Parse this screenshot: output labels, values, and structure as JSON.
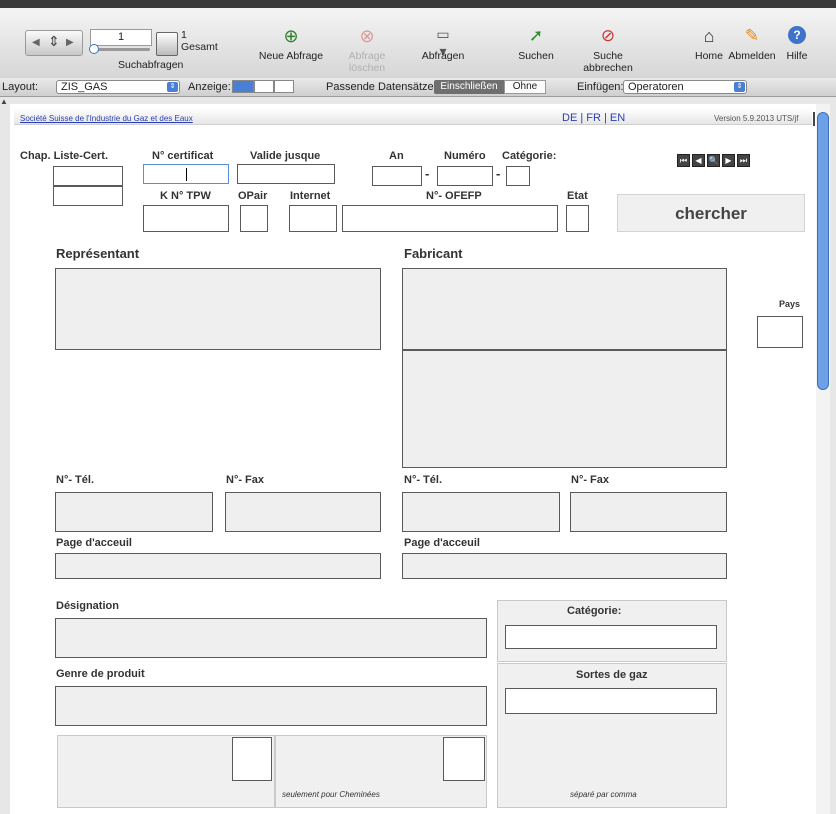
{
  "toolbar": {
    "record_number": "1",
    "total_count": "1",
    "total_label": "Gesamt",
    "search_queries_label": "Suchabfragen",
    "new_query": "Neue Abfrage",
    "delete_query": "Abfrage löschen",
    "queries": "Abfragen",
    "search": "Suchen",
    "cancel_search": "Suche abbrechen",
    "home": "Home",
    "logout": "Abmelden",
    "help": "Hilfe"
  },
  "statusbar": {
    "layout_label": "Layout:",
    "layout_value": "ZIS_GAS",
    "view_label": "Anzeige:",
    "matching_label": "Passende Datensätze:",
    "include": "Einschließen",
    "exclude": "Ohne",
    "insert_label": "Einfügen:",
    "insert_value": "Operatoren"
  },
  "header": {
    "org": "Société Suisse de l'Industrie du Gaz et des Eaux",
    "lang": "DE | FR | EN",
    "version": "Version 5.9.2013 UTS/jf"
  },
  "form": {
    "chap_liste": "Chap. Liste-Cert.",
    "certificat": "N° certificat",
    "valide": "Valide jusque",
    "an": "An",
    "numero": "Numéro",
    "categorie_top": "Catégorie:",
    "kn_tpw": "K N° TPW",
    "opair": "OPair",
    "internet": "Internet",
    "ofefp": "N°- OFEFP",
    "etat": "Etat",
    "dash": "-",
    "search_button": "chercher",
    "representant": "Représentant",
    "fabricant": "Fabricant",
    "pays": "Pays",
    "tel1": "N°- Tél.",
    "fax1": "N°- Fax",
    "tel2": "N°- Tél.",
    "fax2": "N°- Fax",
    "page1": "Page d'acceuil",
    "page2": "Page d'acceuil",
    "designation": "Désignation",
    "categorie": "Catégorie:",
    "genre": "Genre de produit",
    "sortes": "Sortes de gaz",
    "only_chimney": "seulement pour Cheminées",
    "comma_sep": "séparé par comma"
  },
  "colors": {
    "accent_blue": "#3e73c9",
    "link_blue": "#2a3fb3",
    "field_bg": "#efefef"
  }
}
